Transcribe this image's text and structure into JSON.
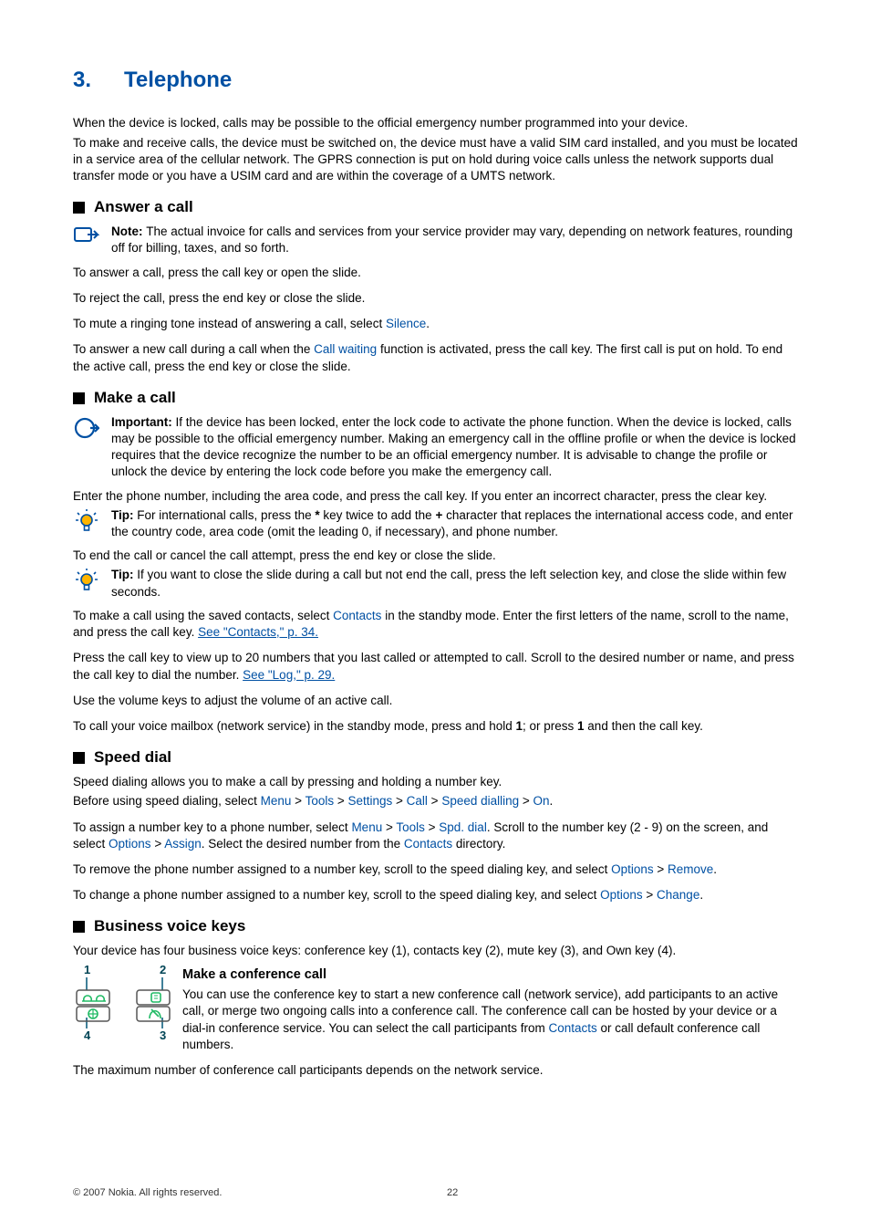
{
  "chapter": {
    "num": "3.",
    "title": "Telephone"
  },
  "intro": {
    "p1": "When the device is locked, calls may be possible to the official emergency number programmed into your device.",
    "p2": "To make and receive calls, the device must be switched on, the device must have a valid SIM card installed, and you must be located in a service area of the cellular network. The GPRS connection is put on hold during voice calls unless the network supports dual transfer mode or you have a USIM card and are within the coverage of a UMTS network."
  },
  "answer": {
    "head": "Answer a call",
    "note_label": "Note:  ",
    "note_text": "The actual invoice for calls and services from your service provider may vary, depending on network features, rounding off for billing, taxes, and so forth.",
    "p1": "To answer a call, press the call key or open the slide.",
    "p2": "To reject the call, press the end key or close the slide.",
    "p3a": "To mute a ringing tone instead of answering a call, select ",
    "p3_silence": "Silence",
    "p3b": ".",
    "p4a": "To answer a new call during a call when the ",
    "p4_cw": "Call waiting",
    "p4b": " function is activated, press the call key. The first call is put on hold. To end the active call, press the end key or close the slide."
  },
  "make": {
    "head": "Make a call",
    "imp_label": "Important:  ",
    "imp_text": "If the device has been locked, enter the lock code to activate the phone function. When the device is locked, calls may be possible to the official emergency number. Making an emergency call in the offline profile or when the device is locked requires that the device recognize the number to be an official emergency number. It is advisable to change the profile or unlock the device by entering the lock code before you make the emergency call.",
    "p1": "Enter the phone number, including the area code, and press the call key. If you enter an incorrect character, press the clear key.",
    "tip1_label": "Tip:  ",
    "tip1_text_a": "For international calls, press the ",
    "tip1_star": "*",
    "tip1_text_b": " key twice to add the ",
    "tip1_plus": "+",
    "tip1_text_c": " character that replaces the international access code, and enter the country code, area code (omit the leading 0, if necessary), and phone number.",
    "p2": "To end the call or cancel the call attempt, press the end key or close the slide.",
    "tip2_label": "Tip:  ",
    "tip2_text": "If you want to close the slide during a call but not end the call, press the left selection key, and close the slide within few seconds.",
    "p3a": "To make a call using the saved contacts, select ",
    "p3_contacts": "Contacts",
    "p3b": " in the standby mode. Enter the first letters of the name, scroll to the name, and press the call key. ",
    "p3_link": "See \"Contacts,\" p. 34.",
    "p4a": "Press the call key to view up to 20 numbers that you last called or attempted to call. Scroll to the desired number or name, and press the call key to dial the number. ",
    "p4_link": "See \"Log,\" p. 29.",
    "p5": "Use the volume keys to adjust the volume of an active call.",
    "p6a": "To call your voice mailbox (network service) in the standby mode, press and hold ",
    "p6_key1a": "1",
    "p6b": "; or press ",
    "p6_key1b": "1",
    "p6c": " and then the call key."
  },
  "speed": {
    "head": "Speed dial",
    "p1": "Speed dialing allows you to make a call by pressing and holding a number key.",
    "p2a": "Before using speed dialing, select ",
    "menu": "Menu",
    "tools": "Tools",
    "settings": "Settings",
    "call": "Call",
    "sd": "Speed dialling",
    "on": "On",
    "p3a": "To assign a number key to a phone number, select ",
    "spd": "Spd. dial",
    "p3b": ". Scroll to the number key (2 - 9) on the screen, and select ",
    "options": "Options",
    "assign": "Assign",
    "p3c": ". Select the desired number from the ",
    "contacts": "Contacts",
    "p3d": " directory.",
    "p4a": "To remove the phone number assigned to a number key, scroll to the speed dialing key, and select ",
    "remove": "Remove",
    "p5a": "To change a phone number assigned to a number key, scroll to the speed dialing key, and select ",
    "change": "Change"
  },
  "bvk": {
    "head": "Business voice keys",
    "p1": "Your device has four business voice keys: conference key (1), contacts key (2), mute key (3), and Own key (4).",
    "sub": "Make a conference call",
    "p2a": "You can use the conference key to start a new conference call (network service), add participants to an active call, or merge two ongoing calls into a conference call. The conference call can be hosted by your device or a dial-in conference service. You can select the call participants from ",
    "contacts": "Contacts",
    "p2b": " or call default conference call numbers.",
    "p3": "The maximum number of conference call participants depends on the network service."
  },
  "footer": {
    "copy": "© 2007 Nokia. All rights reserved.",
    "page": "22"
  },
  "chart_data": null
}
